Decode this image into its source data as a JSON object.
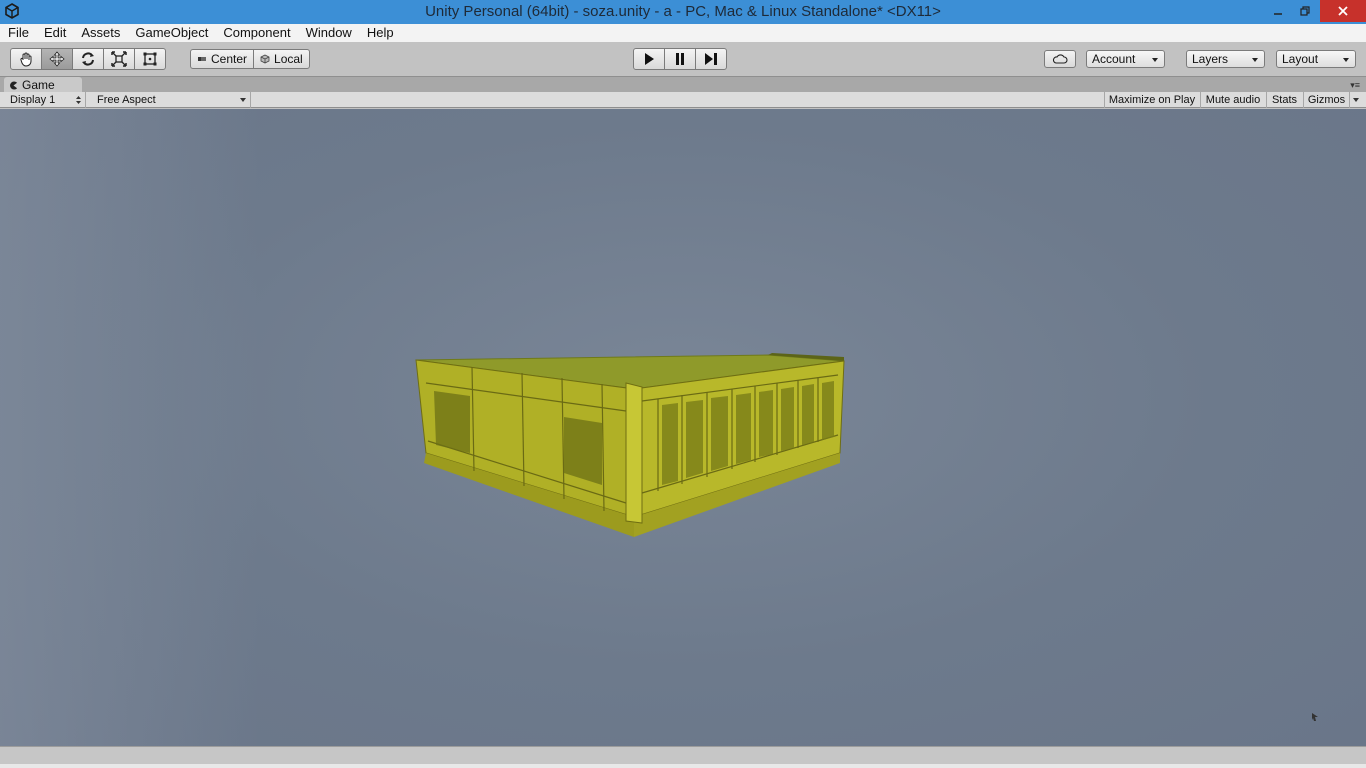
{
  "window": {
    "title": "Unity Personal (64bit) - soza.unity - a - PC, Mac & Linux Standalone* <DX11>",
    "title_bar_color": "#3c8fd6",
    "close_color": "#c7312b"
  },
  "menu": {
    "items": [
      "File",
      "Edit",
      "Assets",
      "GameObject",
      "Component",
      "Window",
      "Help"
    ]
  },
  "toolbar": {
    "tools": [
      {
        "name": "hand-tool",
        "icon": "hand-icon"
      },
      {
        "name": "move-tool",
        "icon": "move-arrows-icon",
        "active": true
      },
      {
        "name": "rotate-tool",
        "icon": "rotate-icon"
      },
      {
        "name": "scale-tool",
        "icon": "scale-icon"
      },
      {
        "name": "rect-tool",
        "icon": "rect-icon"
      }
    ],
    "pivot_label": "Center",
    "space_label": "Local",
    "playback": [
      "play",
      "pause",
      "step"
    ],
    "account_label": "Account",
    "layers_label": "Layers",
    "layout_label": "Layout"
  },
  "panel": {
    "tab_label": "Game"
  },
  "game_toolbar": {
    "display_label": "Display 1",
    "aspect_label": "Free Aspect",
    "maximize_label": "Maximize on Play",
    "mute_label": "Mute audio",
    "stats_label": "Stats",
    "gizmos_label": "Gizmos"
  },
  "viewport": {
    "background_color": "#6d7a8c",
    "object_color": "#b5b52a"
  }
}
